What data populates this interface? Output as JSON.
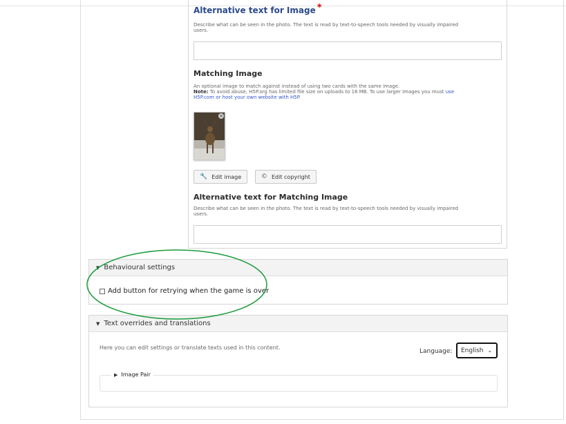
{
  "alt_image": {
    "title": "Alternative text for Image",
    "required_mark": "*",
    "description_line1": "Describe what can be seen in the photo. The text is read by text-to-speech tools needed by visually impaired",
    "description_line2": "users.",
    "value": ""
  },
  "matching_image": {
    "title": "Matching Image",
    "description_line1": "An optional image to match against instead of using two cards with the same image.",
    "note_label": "Note:",
    "note_text": " To avoid abuse, H5P.org has limited file size on uploads to 16 MB. To use larger images you must ",
    "note_link_part1": "use",
    "note_link_part2": "H5P.com or host your own website with H5P",
    "note_end": ".",
    "remove_icon": "×",
    "edit_image_label": "Edit image",
    "edit_copyright_label": "Edit copyright",
    "edit_image_icon": "wrench-icon",
    "edit_copyright_icon": "copyright-icon"
  },
  "alt_matching": {
    "title": "Alternative text for Matching Image",
    "description_line1": "Describe what can be seen in the photo. The text is read by text-to-speech tools needed by visually impaired",
    "description_line2": "users.",
    "value": ""
  },
  "behavioural": {
    "title": "Behavioural settings",
    "retry_label": "Add button for retrying when the game is over",
    "retry_checked": false
  },
  "text_overrides": {
    "title": "Text overrides and translations",
    "description": "Here you can edit settings or translate texts used in this content.",
    "language_label": "Language:",
    "language_value": "English",
    "image_pair_label": "Image Pair"
  },
  "colors": {
    "highlight_annotation": "#1a9a3a",
    "required": "#dd0000",
    "title_blue": "#2b4a8c",
    "link": "#3357c9"
  }
}
